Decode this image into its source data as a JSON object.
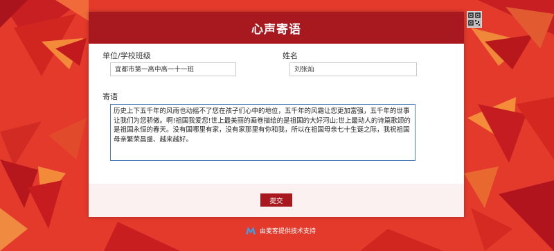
{
  "form": {
    "title": "心声寄语",
    "unit_label": "单位/学校班级",
    "unit_value": "宜都市第一高中高一十一班",
    "name_label": "姓名",
    "name_value": "刘张灿",
    "message_label": "寄语",
    "message_value": "历史上下五千年的风雨也动摇不了您在孩子们心中的地位，五千年的风霜让您更加富强，五千年的世事让我们为您骄傲。啊!祖国我爱您!世上最美丽的画卷描绘的是祖国的大好河山;世上最动人的诗篇歌颂的是祖国永恒的春天。没有国哪里有家，没有家那里有你和我，所以在祖国母亲七十生诞之际，我祝祖国母亲繁荣昌盛、越来越好。",
    "submit_label": "提交"
  },
  "footer": {
    "support_text": "由麦客提供技术支持",
    "logo_icon": "maike-logo-icon"
  },
  "qr": {
    "icon": "qr-code-icon"
  },
  "colors": {
    "background": "#e8382b",
    "header": "#a8181f",
    "button": "#a8181f"
  }
}
